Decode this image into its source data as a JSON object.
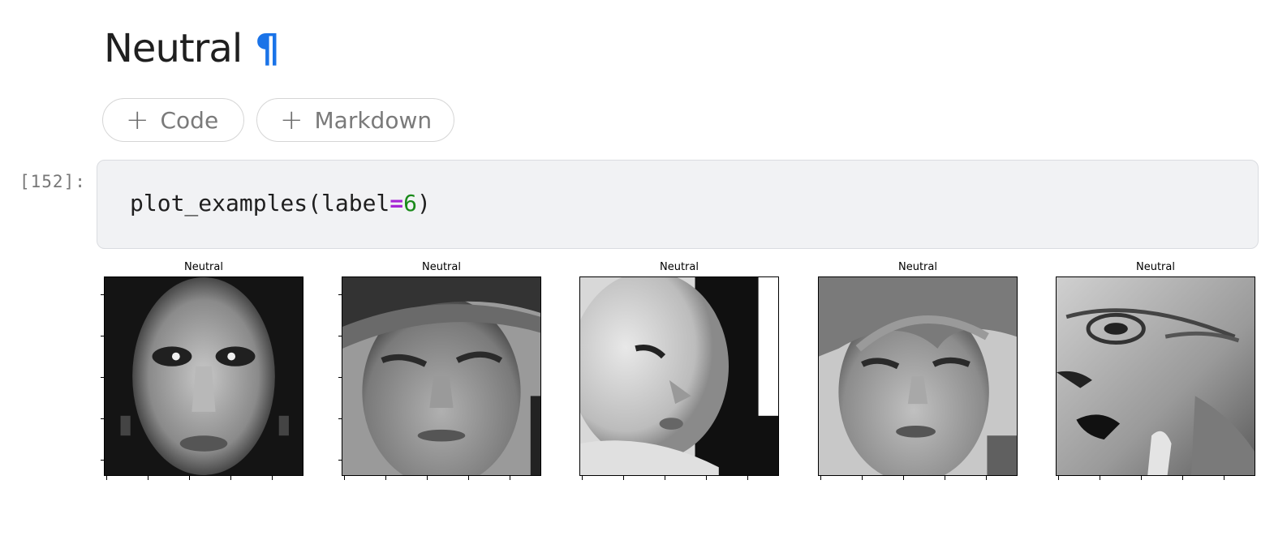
{
  "heading": {
    "title": "Neutral",
    "anchor": "¶"
  },
  "add_buttons": {
    "code_label": "Code",
    "markdown_label": "Markdown",
    "plus": "+"
  },
  "cell": {
    "prompt": "[152]:",
    "code": {
      "fn": "plot_examples(label",
      "op": "=",
      "num": "6",
      "close": ")"
    }
  },
  "output": {
    "subplots": [
      {
        "title": "Neutral"
      },
      {
        "title": "Neutral"
      },
      {
        "title": "Neutral"
      },
      {
        "title": "Neutral"
      },
      {
        "title": "Neutral"
      }
    ]
  }
}
